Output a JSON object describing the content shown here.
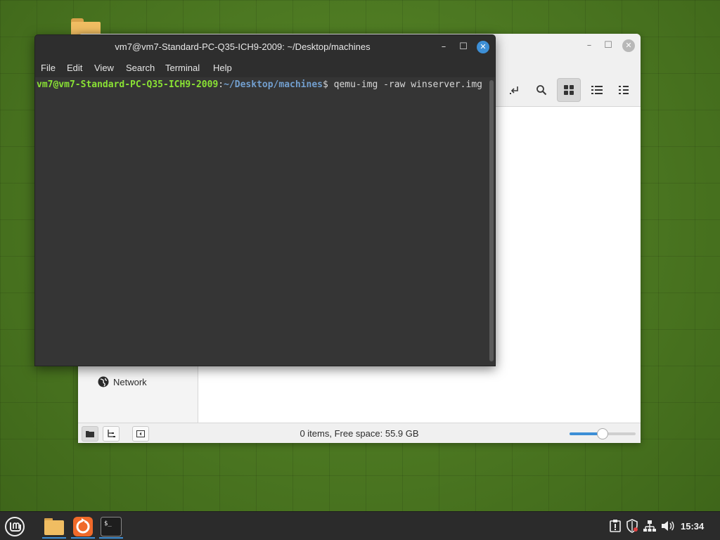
{
  "terminal": {
    "title": "vm7@vm7-Standard-PC-Q35-ICH9-2009: ~/Desktop/machines",
    "menu": [
      "File",
      "Edit",
      "View",
      "Search",
      "Terminal",
      "Help"
    ],
    "prompt_user_host": "vm7@vm7-Standard-PC-Q35-ICH9-2009",
    "prompt_sep": ":",
    "prompt_path": "~/Desktop/machines",
    "prompt_symbol": "$ ",
    "command": "qemu-img -raw winserver.img"
  },
  "file_manager": {
    "sidebar_network_label": "Network",
    "status_text": "0 items, Free space: 55.9 GB",
    "zoom_level": 0.5
  },
  "taskbar": {
    "clock": "15:34"
  },
  "colors": {
    "accent": "#3d8fd6",
    "prompt_user": "#8ae234",
    "prompt_path": "#729fcf",
    "terminal_bg": "#353535",
    "desktop_green": "#4e7a22"
  },
  "icons": {
    "terminal_close": "close-icon",
    "file_manager_search": "search-icon",
    "network": "globe-icon",
    "start_menu": "mint-logo-icon"
  }
}
